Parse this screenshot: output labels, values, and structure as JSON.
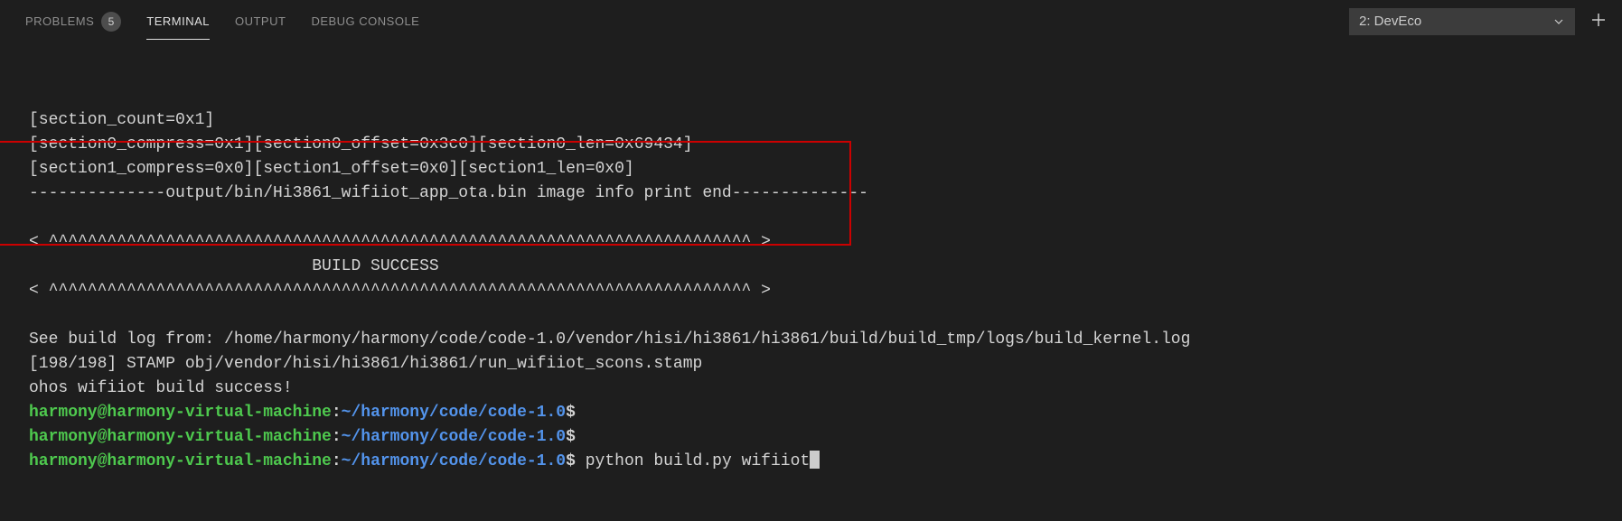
{
  "tabs": {
    "problems": "PROBLEMS",
    "problems_count": "5",
    "terminal": "TERMINAL",
    "output": "OUTPUT",
    "debug_console": "DEBUG CONSOLE"
  },
  "terminal_selector": "2: DevEco",
  "terminal_output": {
    "line1": "[section_count=0x1]",
    "line2": "[section0_compress=0x1][section0_offset=0x3c0][section0_len=0x69434]",
    "line3": "[section1_compress=0x0][section1_offset=0x0][section1_len=0x0]",
    "line4": "--------------output/bin/Hi3861_wifiiot_app_ota.bin image info print end--------------",
    "line5": "",
    "line6": "< ^^^^^^^^^^^^^^^^^^^^^^^^^^^^^^^^^^^^^^^^^^^^^^^^^^^^^^^^^^^^^^^^^^^^^^^^ >",
    "line7": "                             BUILD SUCCESS                              ",
    "line8": "< ^^^^^^^^^^^^^^^^^^^^^^^^^^^^^^^^^^^^^^^^^^^^^^^^^^^^^^^^^^^^^^^^^^^^^^^^ >",
    "line9": "",
    "line10": "See build log from: /home/harmony/harmony/code/code-1.0/vendor/hisi/hi3861/hi3861/build/build_tmp/logs/build_kernel.log",
    "line11": "[198/198] STAMP obj/vendor/hisi/hi3861/hi3861/run_wifiiot_scons.stamp",
    "line12": "ohos wifiiot build success!"
  },
  "prompts": {
    "user_host": "harmony@harmony-virtual-machine",
    "colon": ":",
    "path": "~/harmony/code/code-1.0",
    "dollar": "$",
    "command": " python build.py wifiiot"
  }
}
